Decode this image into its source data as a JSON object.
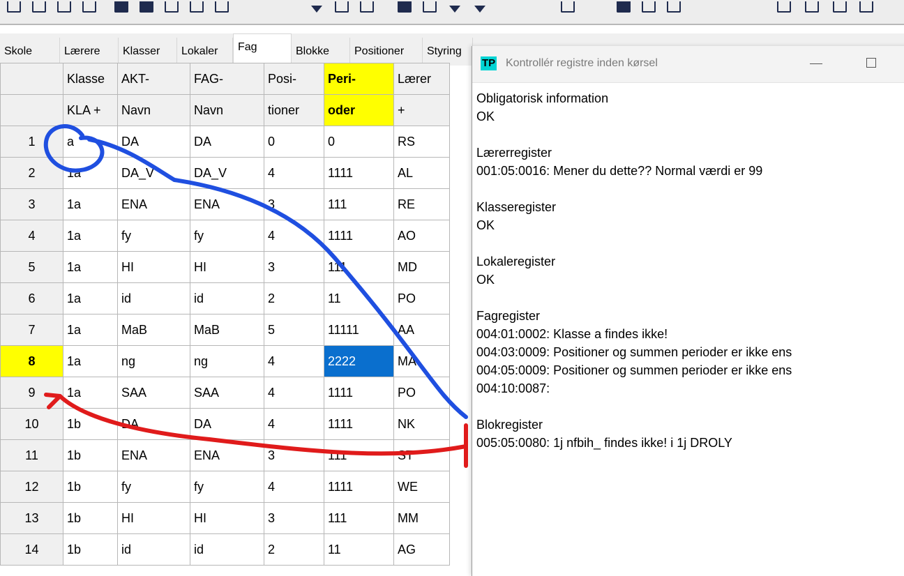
{
  "tabs": [
    "Skole",
    "Lærere",
    "Klasser",
    "Lokaler",
    "Fag",
    "Blokke",
    "Positioner",
    "Styring"
  ],
  "active_tab": "Fag",
  "grid": {
    "header1": [
      "Klasse",
      "AKT-",
      "FAG-",
      "Posi-",
      "Peri-",
      "Lærer"
    ],
    "header2": [
      "KLA +",
      "Navn",
      "Navn",
      "tioner",
      "oder",
      "+"
    ],
    "rows": [
      [
        "1",
        "a",
        "DA",
        "DA",
        "0",
        "0",
        "RS"
      ],
      [
        "2",
        "1a",
        "DA_V",
        "DA_V",
        "4",
        "1111",
        "AL"
      ],
      [
        "3",
        "1a",
        "ENA",
        "ENA",
        "3",
        "111",
        "RE"
      ],
      [
        "4",
        "1a",
        "fy",
        "fy",
        "4",
        "1111",
        "AO"
      ],
      [
        "5",
        "1a",
        "HI",
        "HI",
        "3",
        "111",
        "MD"
      ],
      [
        "6",
        "1a",
        "id",
        "id",
        "2",
        "11",
        "PO"
      ],
      [
        "7",
        "1a",
        "MaB",
        "MaB",
        "5",
        "11111",
        "AA"
      ],
      [
        "8",
        "1a",
        "ng",
        "ng",
        "4",
        "2222",
        "MA"
      ],
      [
        "9",
        "1a",
        "SAA",
        "SAA",
        "4",
        "1111",
        "PO"
      ],
      [
        "10",
        "1b",
        "DA",
        "DA",
        "4",
        "1111",
        "NK"
      ],
      [
        "11",
        "1b",
        "ENA",
        "ENA",
        "3",
        "111",
        "ST"
      ],
      [
        "12",
        "1b",
        "fy",
        "fy",
        "4",
        "1111",
        "WE"
      ],
      [
        "13",
        "1b",
        "HI",
        "HI",
        "3",
        "111",
        "MM"
      ],
      [
        "14",
        "1b",
        "id",
        "id",
        "2",
        "11",
        "AG"
      ]
    ],
    "selected_row": "8",
    "selected_cell_value": "2222"
  },
  "dialog": {
    "icon_text": "TP",
    "title": "Kontrollér registre inden kørsel",
    "lines": [
      "Obligatorisk information",
      "OK",
      "",
      "Lærerregister",
      "001:05:0016: Mener du dette?? Normal værdi er 99",
      "",
      "Klasseregister",
      "OK",
      "",
      "Lokaleregister",
      "OK",
      "",
      "Fagregister",
      "004:01:0002: Klasse a findes ikke!",
      "004:03:0009: Positioner og summen perioder er ikke ens",
      "004:05:0009: Positioner og summen perioder er ikke ens",
      "004:10:0087:",
      "",
      "Blokregister",
      "005:05:0080: 1j nfbih_ findes ikke! i 1j DROLY"
    ]
  },
  "colors": {
    "highlight": "#ffff00",
    "selection": "#0a6fce",
    "annotation_blue": "#1f4fe0",
    "annotation_red": "#e01b1b",
    "tp_icon": "#00d4d4"
  }
}
